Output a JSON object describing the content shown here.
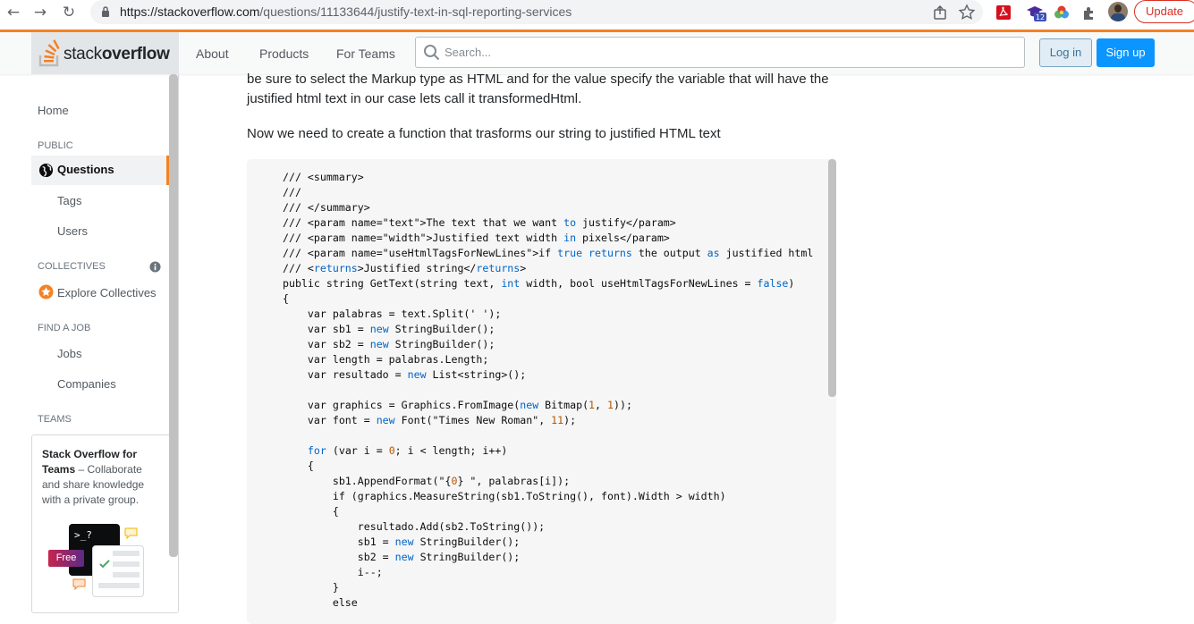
{
  "browser": {
    "url_host": "https://stackoverflow.com",
    "url_path": "/questions/11133644/justify-text-in-sql-reporting-services",
    "update_label": "Update",
    "extension_badge": "12"
  },
  "header": {
    "logo_light": "stack",
    "logo_bold": "overflow",
    "nav": [
      "About",
      "Products",
      "For Teams"
    ],
    "search_placeholder": "Search...",
    "login_label": "Log in",
    "signup_label": "Sign up"
  },
  "sidebar": {
    "home": "Home",
    "public_label": "PUBLIC",
    "questions": "Questions",
    "tags": "Tags",
    "users": "Users",
    "collectives_label": "COLLECTIVES",
    "explore_collectives": "Explore Collectives",
    "find_job_label": "FIND A JOB",
    "jobs": "Jobs",
    "companies": "Companies",
    "teams_label": "TEAMS",
    "teams_title": "Stack Overflow for Teams",
    "teams_desc": " – Collaborate and share knowledge with a private group.",
    "free_badge": "Free",
    "prompt_text": ">_?"
  },
  "content": {
    "para1": "be sure to select the Markup type as HTML and for the value specify the variable that will have the justified html text in our case lets call it transformedHtml.",
    "para2": "Now we need to create a function that trasforms our string to justified HTML text",
    "code": [
      "/// <summary>",
      "///",
      "/// </summary>",
      "/// <param name=\"text\">The text that we want to justify</param>",
      "/// <param name=\"width\">Justified text width in pixels</param>",
      "/// <param name=\"useHtmlTagsForNewLines\">if true returns the output as justified html",
      "/// <returns>Justified string</returns>",
      "public string GetText(string text, int width, bool useHtmlTagsForNewLines = false)",
      "{",
      "    var palabras = text.Split(' ');",
      "    var sb1 = new StringBuilder();",
      "    var sb2 = new StringBuilder();",
      "    var length = palabras.Length;",
      "    var resultado = new List<string>();",
      "",
      "    var graphics = Graphics.FromImage(new Bitmap(1, 1));",
      "    var font = new Font(\"Times New Roman\", 11);",
      "",
      "    for (var i = 0; i < length; i++)",
      "    {",
      "        sb1.AppendFormat(\"{0} \", palabras[i]);",
      "        if (graphics.MeasureString(sb1.ToString(), font).Width > width)",
      "        {",
      "            resultado.Add(sb2.ToString());",
      "            sb1 = new StringBuilder();",
      "            sb2 = new StringBuilder();",
      "            i--;",
      "        }",
      "        else"
    ]
  },
  "colors": {
    "accent": "#f48225",
    "link_blue": "#0a95ff",
    "keyword": "#0064c8",
    "number": "#b75501"
  }
}
